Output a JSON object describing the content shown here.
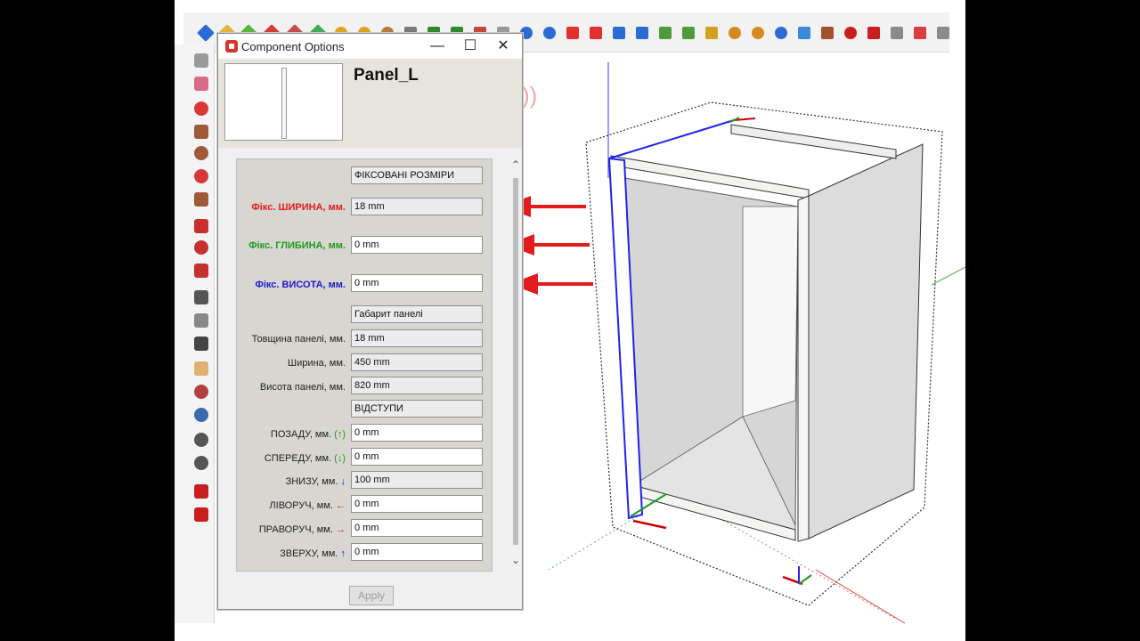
{
  "window": {
    "title": "Component Options",
    "minimize_symbol": "—",
    "maximize_symbol": "☐",
    "close_symbol": "✕"
  },
  "component": {
    "name": "Panel_L"
  },
  "form": {
    "sections": {
      "fixed_header": "ФІКСОВАНІ РОЗМІРИ",
      "gabarit_header": "Габарит панелі",
      "offsets_header": "ВІДСТУПИ"
    },
    "fixed_width": {
      "label": "Фікс. ШИРИНА, мм.",
      "value": "18 mm",
      "color": "#e31b1b"
    },
    "fixed_depth": {
      "label": "Фікс. ГЛИБИНА, мм.",
      "value": "0 mm",
      "color": "#1e9a1e"
    },
    "fixed_height": {
      "label": "Фікс. ВИСОТА, мм.",
      "value": "0 mm",
      "color": "#1b1bcc"
    },
    "thickness": {
      "label": "Товщина панелі, мм.",
      "value": "18 mm"
    },
    "width": {
      "label": "Ширина, мм.",
      "value": "450 mm"
    },
    "panel_height": {
      "label": "Висота панелі, мм.",
      "value": "820 mm"
    },
    "back": {
      "label": "ПОЗАДУ, мм.",
      "arrow": "(↑)",
      "value": "0 mm"
    },
    "front": {
      "label": "СПЕРЕДУ, мм.",
      "arrow": "(↓)",
      "value": "0 mm"
    },
    "bottom": {
      "label": "ЗНИЗУ, мм.",
      "arrow": "↓",
      "value": "100 mm"
    },
    "left": {
      "label": "ЛІВОРУЧ, мм.",
      "arrow": "←",
      "value": "0 mm"
    },
    "right": {
      "label": "ПРАВОРУЧ, мм.",
      "arrow": "→",
      "value": "0 mm"
    },
    "top": {
      "label": "ЗВЕРХУ, мм.",
      "arrow": "↑",
      "value": "0 mm"
    }
  },
  "buttons": {
    "apply": "Apply"
  },
  "colors": {
    "arrow_red": "#e31b1b",
    "axis_green": "#1e9a1e",
    "axis_blue": "#1b1bcc",
    "panel_fill": "#f0efea",
    "interior_fill": "#d8d8d8"
  }
}
